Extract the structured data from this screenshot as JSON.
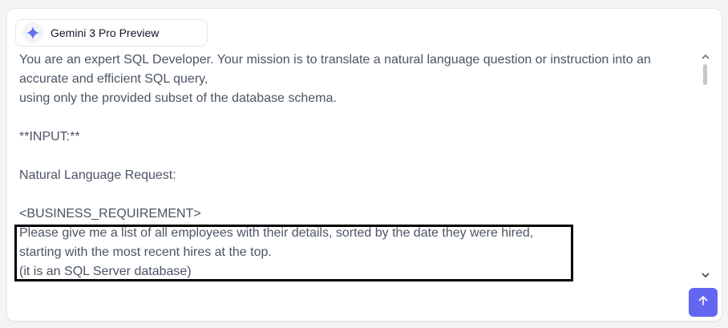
{
  "model_selector": {
    "label": "Gemini 3 Pro Preview",
    "icon": "gemini-sparkle-icon"
  },
  "prompt": {
    "lines": [
      "You are an expert SQL Developer. Your mission is to translate a natural language question or instruction into an",
      "accurate and efficient SQL query,",
      "using only the provided subset of the database schema.",
      "",
      "**INPUT:**",
      "",
      "Natural Language Request:",
      "",
      "<BUSINESS_REQUIREMENT>",
      "Please give me a list of all employees with their details, sorted by the date they were hired,",
      "starting with the most recent hires at the top.",
      "(it is an SQL Server database)"
    ]
  },
  "scrollbar": {
    "up_icon": "chevron-up-icon",
    "down_icon": "chevron-down-icon"
  },
  "send_button": {
    "icon": "arrow-up-icon",
    "color": "#6366f1"
  },
  "colors": {
    "text": "#4b5563",
    "highlight_border": "#000000",
    "accent": "#6366f1"
  }
}
